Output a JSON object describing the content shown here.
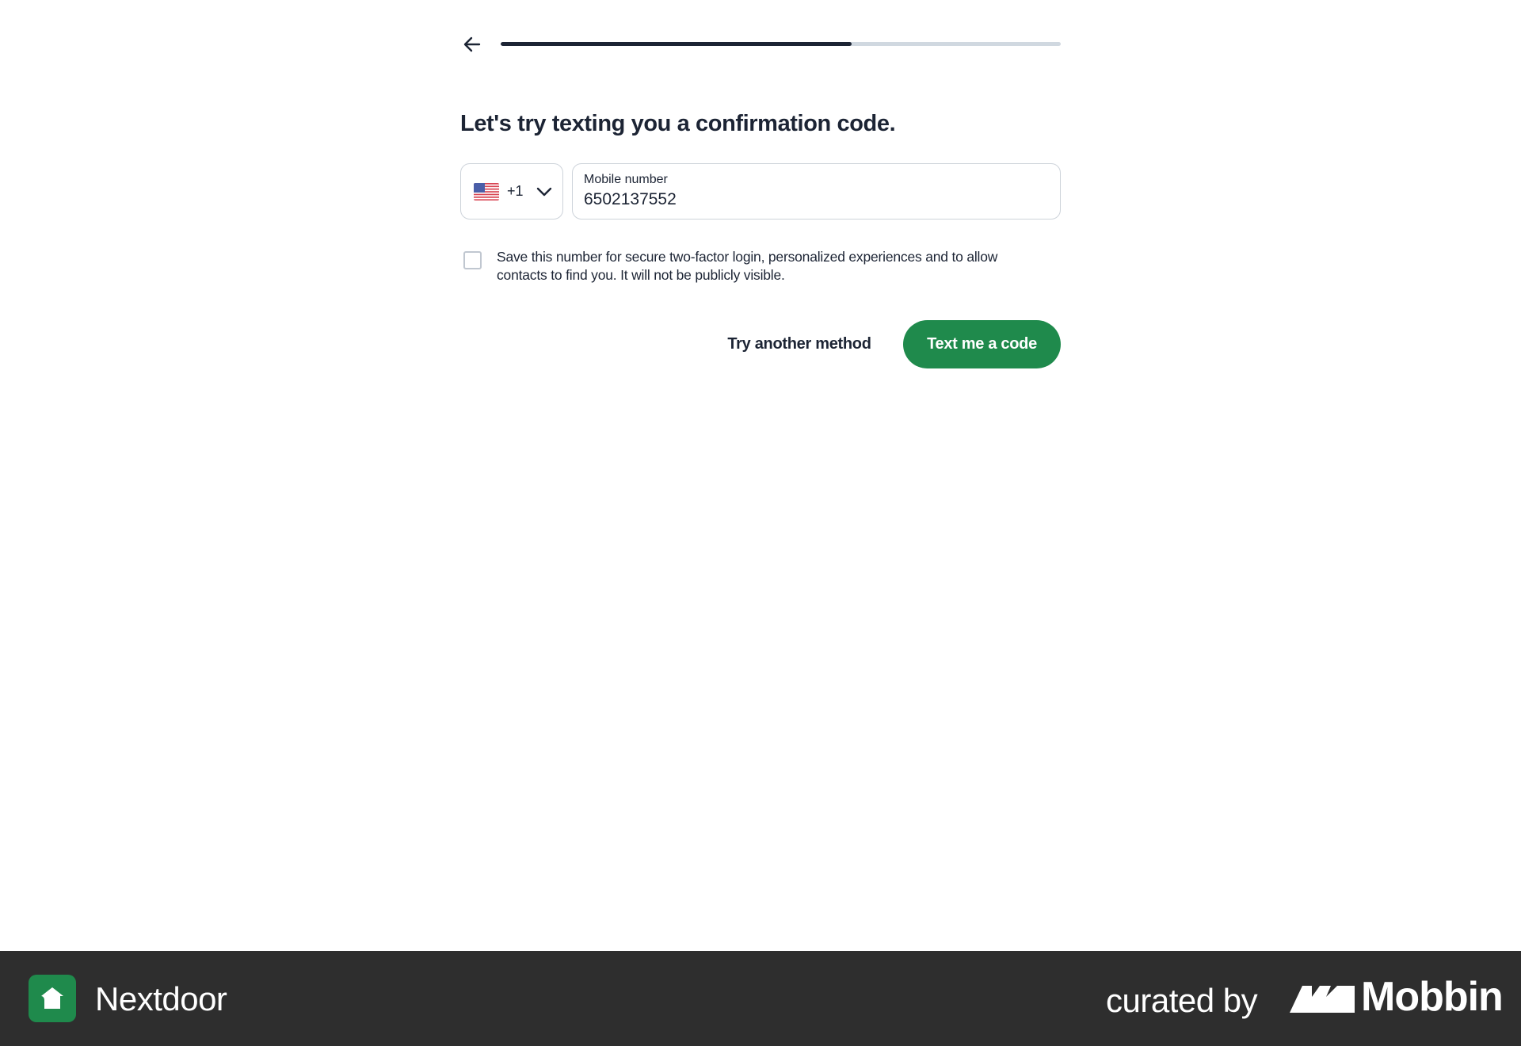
{
  "header": {
    "progress": 0.626
  },
  "heading": "Let's try texting you a confirmation code.",
  "country_select": {
    "dial_code": "+1",
    "flag": "us-flag-icon"
  },
  "phone_field": {
    "label": "Mobile number",
    "value": "6502137552"
  },
  "consent": {
    "checked": false,
    "text": "Save this number for secure two-factor login, personalized experiences and to allow contacts to find you. It will not be publicly visible."
  },
  "actions": {
    "secondary_label": "Try another method",
    "primary_label": "Text me a code"
  },
  "colors": {
    "primary": "#1f8a4c",
    "text": "#1c2434",
    "footer": "#2e2e2e"
  },
  "footer": {
    "app_name": "Nextdoor",
    "curated_by": "curated by",
    "brand": "Mobbin"
  }
}
